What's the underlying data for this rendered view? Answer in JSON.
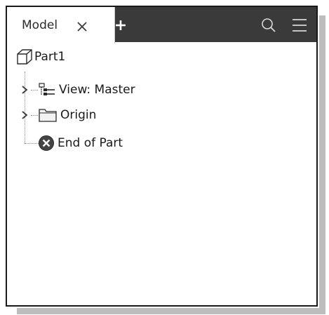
{
  "browser": {
    "active_tab_label": "Model",
    "close_label": "Close Model tab",
    "add_label": "Add browser",
    "search_label": "Search",
    "menu_label": "Browser menu"
  },
  "tree": {
    "root": {
      "label": "Part1",
      "icon": "part-cube-icon"
    },
    "items": [
      {
        "label": "View: Master",
        "icon": "view-rep-icon",
        "expandable": true
      },
      {
        "label": "Origin",
        "icon": "folder-icon",
        "expandable": true
      },
      {
        "label": "End of Part",
        "icon": "end-of-part-icon",
        "expandable": false
      }
    ]
  },
  "colors": {
    "tabbar": "#3a3a3a",
    "panel_border": "#1a1a1a",
    "end_of_part": "#444444"
  }
}
